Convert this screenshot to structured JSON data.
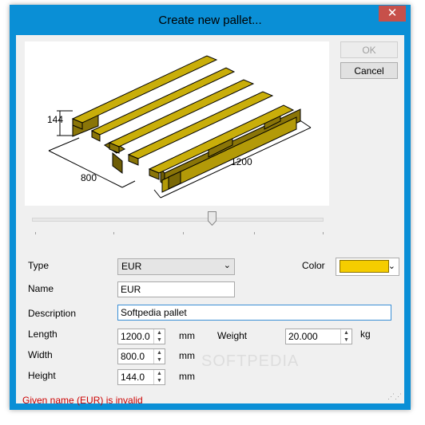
{
  "window": {
    "title": "Create new pallet...",
    "close_glyph": "✕"
  },
  "buttons": {
    "ok": "OK",
    "cancel": "Cancel"
  },
  "preview": {
    "dimension_height": "144",
    "dimension_width": "800",
    "dimension_length": "1200",
    "pallet_color": "#c9ae0a"
  },
  "form": {
    "type_label": "Type",
    "type_value": "EUR",
    "color_label": "Color",
    "color_value": "#f5cd00",
    "name_label": "Name",
    "name_value": "EUR",
    "description_label": "Description",
    "description_value": "Softpedia pallet",
    "length_label": "Length",
    "length_value": "1200.0",
    "length_unit": "mm",
    "width_label": "Width",
    "width_value": "800.0",
    "width_unit": "mm",
    "height_label": "Height",
    "height_value": "144.0",
    "height_unit": "mm",
    "weight_label": "Weight",
    "weight_value": "20.000",
    "weight_unit": "kg"
  },
  "status": {
    "message": "Given name (EUR) is invalid"
  },
  "watermark": "SOFTPEDIA"
}
